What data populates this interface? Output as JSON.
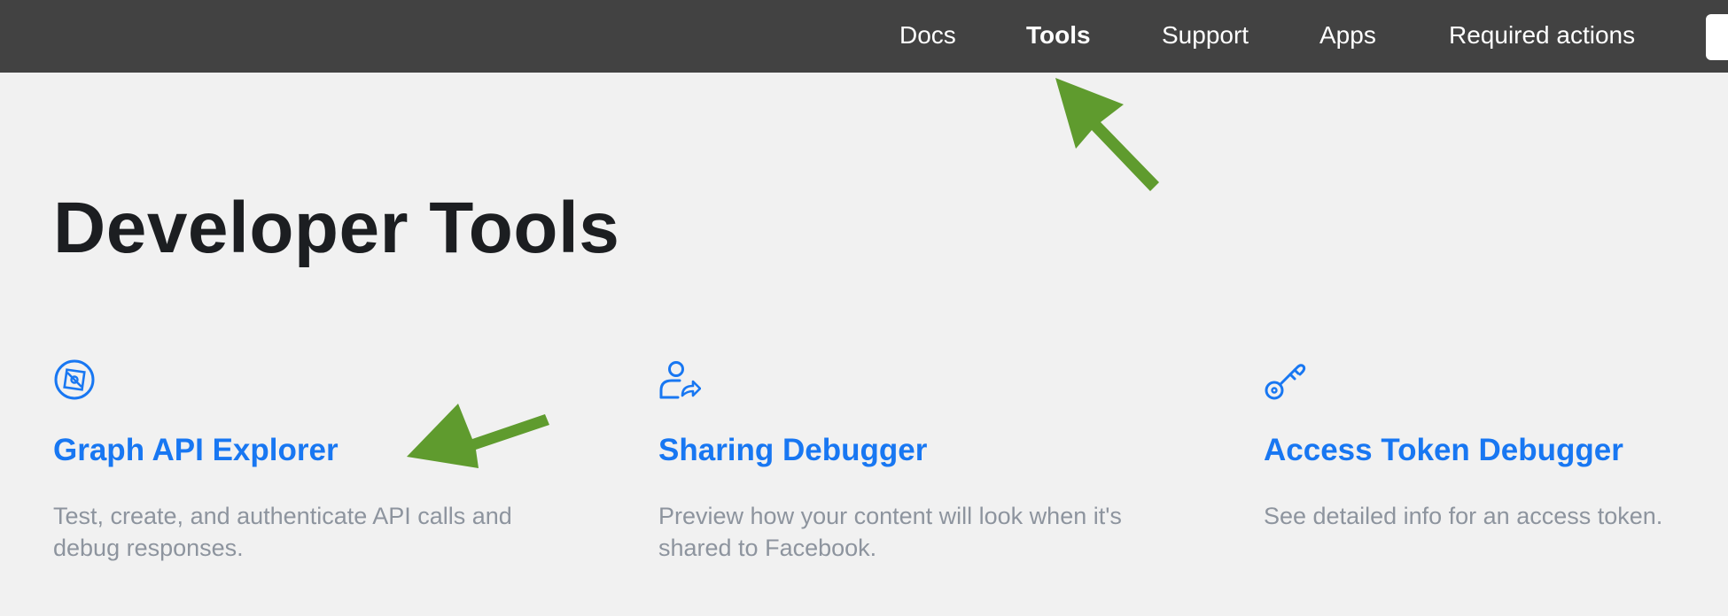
{
  "header": {
    "nav": [
      {
        "label": "Docs",
        "active": false
      },
      {
        "label": "Tools",
        "active": true
      },
      {
        "label": "Support",
        "active": false
      },
      {
        "label": "Apps",
        "active": false
      },
      {
        "label": "Required actions",
        "active": false
      }
    ]
  },
  "main": {
    "title": "Developer Tools",
    "cards": [
      {
        "icon": "compass-icon",
        "title": "Graph API Explorer",
        "description": "Test, create, and authenticate API calls and debug responses."
      },
      {
        "icon": "user-share-icon",
        "title": "Sharing Debugger",
        "description": "Preview how your content will look when it's shared to Facebook."
      },
      {
        "icon": "key-icon",
        "title": "Access Token Debugger",
        "description": "See detailed info for an access token."
      }
    ]
  },
  "colors": {
    "topbar": "#424242",
    "background": "#f1f1f1",
    "link": "#1877f2",
    "heading": "#1c1e21",
    "description": "#8d949e",
    "annotation_arrow": "#5f9b2e"
  }
}
